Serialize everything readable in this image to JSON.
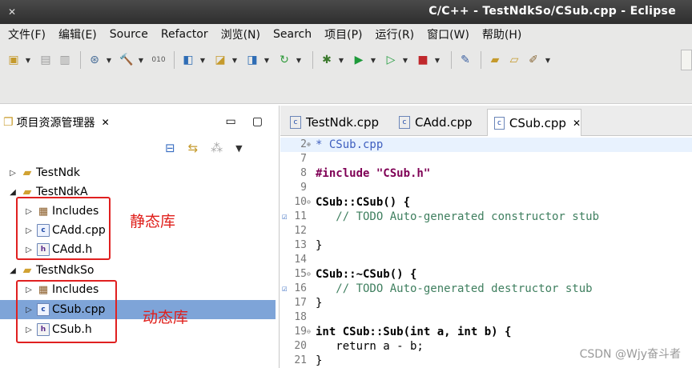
{
  "window": {
    "title": "C/C++ - TestNdkSo/CSub.cpp - Eclipse",
    "close_glyph": "✕"
  },
  "menu": [
    "文件(F)",
    "编辑(E)",
    "Source",
    "Refactor",
    "浏览(N)",
    "Search",
    "项目(P)",
    "运行(R)",
    "窗口(W)",
    "帮助(H)"
  ],
  "toolbar_icons": [
    "new-icon",
    "save-icon",
    "save-all-icon",
    "debug-config-icon",
    "hammer-build-icon",
    "binary-icon",
    "new-class-icon",
    "new-folder-icon",
    "new-source-icon",
    "refresh-icon",
    "bug-debug-icon",
    "run-icon",
    "run-config-icon",
    "stop-icon",
    "pin-icon",
    "open-folder-icon",
    "open-icon",
    "brush-icon"
  ],
  "project_explorer": {
    "tab_label": "项目资源管理器",
    "items": [
      {
        "label": "TestNdk",
        "type": "project",
        "expanded": false
      },
      {
        "label": "TestNdkA",
        "type": "project",
        "expanded": true
      },
      {
        "label": "Includes",
        "type": "includes",
        "expanded": false
      },
      {
        "label": "CAdd.cpp",
        "type": "cpp",
        "expanded": false
      },
      {
        "label": "CAdd.h",
        "type": "h",
        "expanded": false
      },
      {
        "label": "TestNdkSo",
        "type": "project",
        "expanded": true
      },
      {
        "label": "Includes",
        "type": "includes",
        "expanded": false
      },
      {
        "label": "CSub.cpp",
        "type": "cpp",
        "expanded": false,
        "selected": true
      },
      {
        "label": "CSub.h",
        "type": "h",
        "expanded": false
      }
    ],
    "annotations": {
      "static_lib": "静态库",
      "dynamic_lib": "动态库"
    }
  },
  "editor": {
    "tabs": [
      {
        "label": "TestNdk.cpp",
        "active": false
      },
      {
        "label": "CAdd.cpp",
        "active": false
      },
      {
        "label": "CSub.cpp",
        "active": true
      }
    ],
    "lines": [
      {
        "num": "2",
        "text": "* CSub.cpp",
        "fold": "⊕"
      },
      {
        "num": "7",
        "text": ""
      },
      {
        "num": "8",
        "text": "#include \"CSub.h\""
      },
      {
        "num": "9",
        "text": ""
      },
      {
        "num": "10",
        "text": "CSub::CSub() {",
        "fold": "⊖"
      },
      {
        "num": "11",
        "text": "   // TODO Auto-generated constructor stub",
        "mark": "task"
      },
      {
        "num": "12",
        "text": ""
      },
      {
        "num": "13",
        "text": "}"
      },
      {
        "num": "14",
        "text": ""
      },
      {
        "num": "15",
        "text": "CSub::~CSub() {",
        "fold": "⊖"
      },
      {
        "num": "16",
        "text": "   // TODO Auto-generated destructor stub",
        "mark": "task"
      },
      {
        "num": "17",
        "text": "}"
      },
      {
        "num": "18",
        "text": ""
      },
      {
        "num": "19",
        "text": "int CSub::Sub(int a, int b) {",
        "fold": "⊖"
      },
      {
        "num": "20",
        "text": "   return a - b;"
      },
      {
        "num": "21",
        "text": "}"
      }
    ]
  },
  "watermark": "CSDN @Wjy奋斗者"
}
